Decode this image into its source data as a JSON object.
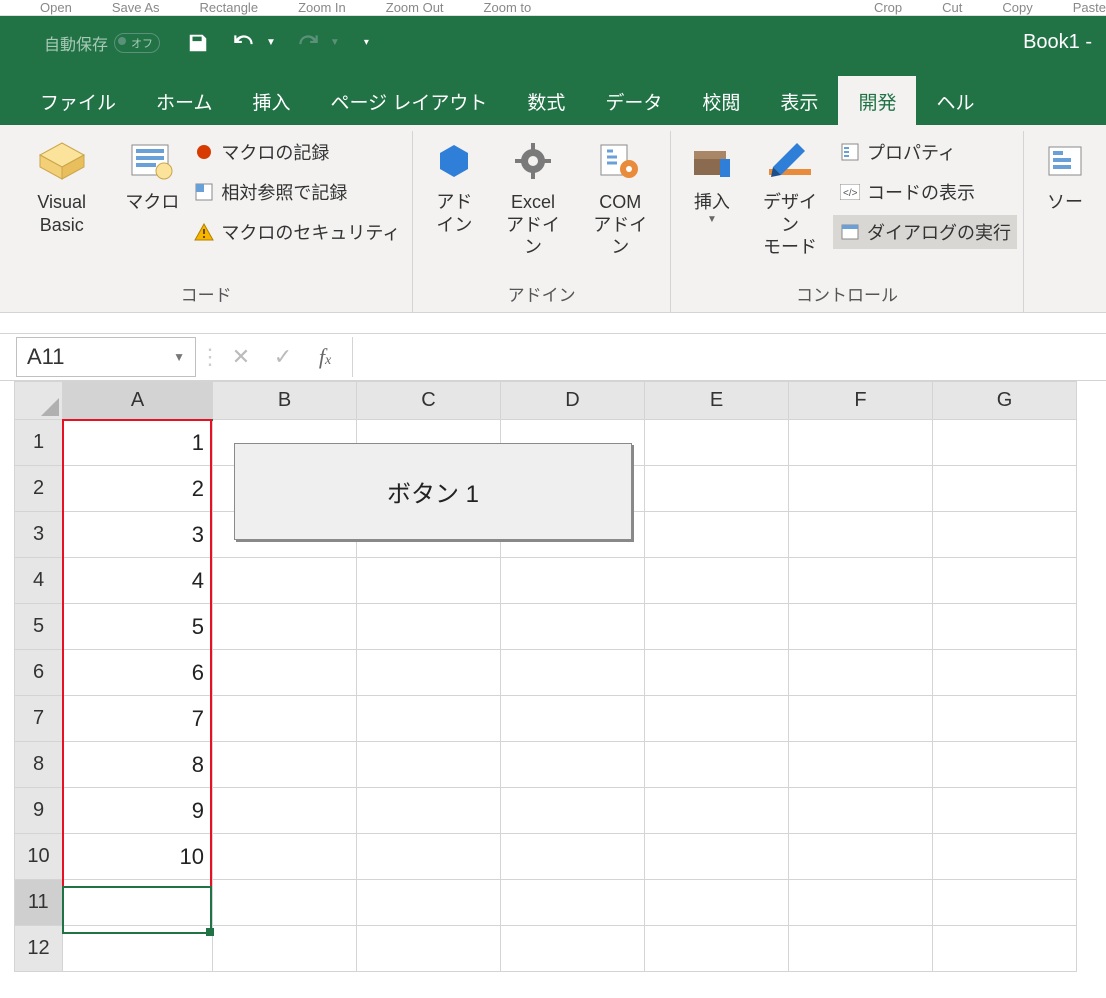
{
  "toolbar_ghost": [
    "Open",
    "Save As",
    "Rectangle",
    "Zoom In",
    "Zoom Out",
    "Zoom to",
    "Crop",
    "Cut",
    "Copy",
    "Paste"
  ],
  "title": "Book1  -",
  "autosave": {
    "label": "自動保存",
    "state": "オフ"
  },
  "qat": {
    "customize_tip": "▾"
  },
  "tabs": [
    "ファイル",
    "ホーム",
    "挿入",
    "ページ レイアウト",
    "数式",
    "データ",
    "校閲",
    "表示",
    "開発",
    "ヘル"
  ],
  "active_tab_index": 8,
  "ribbon": {
    "groups": [
      {
        "label": "コード",
        "items": {
          "vb": "Visual Basic",
          "macro": "マクロ",
          "record": "マクロの記録",
          "relative": "相対参照で記録",
          "security": "マクロのセキュリティ"
        }
      },
      {
        "label": "アドイン",
        "items": {
          "addin": "アド\nイン",
          "excel_addin": "Excel\nアドイン",
          "com_addin": "COM\nアドイン"
        }
      },
      {
        "label": "コントロール",
        "items": {
          "insert": "挿入",
          "design": "デザイン\nモード",
          "properties": "プロパティ",
          "view_code": "コードの表示",
          "run_dialog": "ダイアログの実行"
        }
      },
      {
        "label": "",
        "items": {
          "source": "ソー"
        }
      }
    ]
  },
  "name_box": "A11",
  "formula_value": "",
  "columns": [
    "A",
    "B",
    "C",
    "D",
    "E",
    "F",
    "G"
  ],
  "rows": [
    "1",
    "2",
    "3",
    "4",
    "5",
    "6",
    "7",
    "8",
    "9",
    "10",
    "11",
    "12"
  ],
  "cells": {
    "A1": "1",
    "A2": "2",
    "A3": "3",
    "A4": "4",
    "A5": "5",
    "A6": "6",
    "A7": "7",
    "A8": "8",
    "A9": "9",
    "A10": "10"
  },
  "form_controls": {
    "button1_label": "ボタン 1"
  },
  "selection": {
    "active_cell": "A11"
  }
}
